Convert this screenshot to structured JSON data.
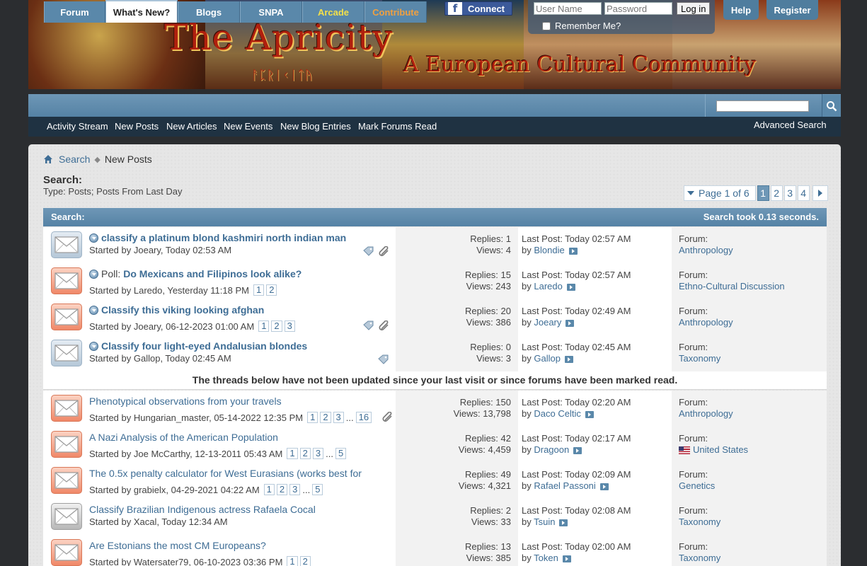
{
  "header": {
    "site_title": "The Apricity",
    "site_subtitle": "A European Cultural Community",
    "runes": "ᚨᛈᚱᛁᚲᛁᛏᚤ",
    "fb_connect": "Connect",
    "username_placeholder": "User Name",
    "password_placeholder": "Password",
    "login_label": "Log in",
    "remember_label": "Remember Me?",
    "help_label": "Help",
    "register_label": "Register"
  },
  "nav": {
    "tabs": [
      "Forum",
      "What's New?",
      "Blogs",
      "SNPA",
      "Arcade",
      "Contribute"
    ],
    "active_tab": "What's New?",
    "sub_links": [
      "Activity Stream",
      "New Posts",
      "New Articles",
      "New Events",
      "New Blog Entries",
      "Mark Forums Read"
    ],
    "advanced_search": "Advanced Search"
  },
  "breadcrumb": {
    "link": "Search",
    "current": "New Posts"
  },
  "search_info": {
    "heading": "Search:",
    "type": "Type: Posts; Posts From Last Day",
    "header_left": "Search:",
    "header_right": "Search took 0.13 seconds."
  },
  "pager": {
    "label": "Page 1 of 6",
    "pages": [
      "1",
      "2",
      "3",
      "4"
    ],
    "current": "1"
  },
  "notice": "The threads below have not been updated since your last visit or since forums have been marked read.",
  "threads": [
    {
      "icon": "blue",
      "new": true,
      "prefix": "",
      "title": "classify a platinum blond kashmiri north indian man",
      "bold": true,
      "started": "Started by Joeary, Today 02:53 AM",
      "pages": [],
      "replies": "Replies: 1",
      "views": "Views: 4",
      "last_post": "Last Post: Today 02:57 AM",
      "last_by_prefix": "by",
      "last_by": "Blondie",
      "forum_label": "Forum:",
      "forum": "Anthropology",
      "tags": true,
      "attach": true
    },
    {
      "icon": "orange",
      "new": true,
      "prefix": "Poll:",
      "title": "Do Mexicans and Filipinos look alike?",
      "bold": true,
      "started": "Started by Laredo, Yesterday 11:18 PM",
      "pages": [
        "1",
        "2"
      ],
      "replies": "Replies: 15",
      "views": "Views: 243",
      "last_post": "Last Post: Today 02:57 AM",
      "last_by_prefix": "by",
      "last_by": "Laredo",
      "forum_label": "Forum:",
      "forum": "Ethno-Cultural Discussion",
      "tags": false,
      "attach": false
    },
    {
      "icon": "orange",
      "new": true,
      "prefix": "",
      "title": "Classify this viking looking afghan",
      "bold": true,
      "started": "Started by Joeary, 06-12-2023 01:00 AM",
      "pages": [
        "1",
        "2",
        "3"
      ],
      "replies": "Replies: 20",
      "views": "Views: 386",
      "last_post": "Last Post: Today 02:49 AM",
      "last_by_prefix": "by",
      "last_by": "Joeary",
      "forum_label": "Forum:",
      "forum": "Anthropology",
      "tags": true,
      "attach": true
    },
    {
      "icon": "blue",
      "new": true,
      "prefix": "",
      "title": "Classify four light-eyed Andalusian blondes",
      "bold": true,
      "started": "Started by Gallop, Today 02:45 AM",
      "pages": [],
      "replies": "Replies: 0",
      "views": "Views: 3",
      "last_post": "Last Post: Today 02:45 AM",
      "last_by_prefix": "by",
      "last_by": "Gallop",
      "forum_label": "Forum:",
      "forum": "Taxonomy",
      "tags": true,
      "attach": false
    },
    {
      "icon": "orange",
      "new": false,
      "prefix": "",
      "title": "Phenotypical observations from your travels",
      "bold": false,
      "started": "Started by Hungarian_master, 05-14-2022 12:35 PM",
      "pages": [
        "1",
        "2",
        "3",
        "...",
        "16"
      ],
      "replies": "Replies: 150",
      "views": "Views: 13,798",
      "last_post": "Last Post: Today 02:20 AM",
      "last_by_prefix": "by",
      "last_by": "Daco Celtic",
      "forum_label": "Forum:",
      "forum": "Anthropology",
      "tags": false,
      "attach": true
    },
    {
      "icon": "orange",
      "new": false,
      "prefix": "",
      "title": "A Nazi Analysis of the American Population",
      "bold": false,
      "started": "Started by Joe McCarthy, 12-13-2011 05:43 AM",
      "pages": [
        "1",
        "2",
        "3",
        "...",
        "5"
      ],
      "replies": "Replies: 42",
      "views": "Views: 4,459",
      "last_post": "Last Post: Today 02:17 AM",
      "last_by_prefix": "by",
      "last_by": "Dragoon",
      "forum_label": "Forum:",
      "forum": "United States",
      "flag": true,
      "tags": false,
      "attach": false
    },
    {
      "icon": "orange",
      "new": false,
      "prefix": "",
      "title": "The 0.5x penalty calculator for West Eurasians (works best for",
      "bold": false,
      "started": "Started by grabielx, 04-29-2021 04:22 AM",
      "pages": [
        "1",
        "2",
        "3",
        "...",
        "5"
      ],
      "replies": "Replies: 49",
      "views": "Views: 4,321",
      "last_post": "Last Post: Today 02:09 AM",
      "last_by_prefix": "by",
      "last_by": "Rafael Passoni",
      "forum_label": "Forum:",
      "forum": "Genetics",
      "tags": false,
      "attach": false
    },
    {
      "icon": "grey",
      "new": false,
      "prefix": "",
      "title": "Classify Brazilian Indigenous actress Rafaela Cocal",
      "bold": false,
      "started": "Started by Xacal, Today 12:34 AM",
      "pages": [],
      "replies": "Replies: 2",
      "views": "Views: 33",
      "last_post": "Last Post: Today 02:08 AM",
      "last_by_prefix": "by",
      "last_by": "Tsuin",
      "forum_label": "Forum:",
      "forum": "Taxonomy",
      "tags": false,
      "attach": false
    },
    {
      "icon": "orange",
      "new": false,
      "prefix": "",
      "title": "Are Estonians the most CM Europeans?",
      "bold": false,
      "started": "Started by Watersater79, 06-10-2023 03:36 PM",
      "pages": [
        "1",
        "2"
      ],
      "replies": "Replies: 13",
      "views": "Views: 385",
      "last_post": "Last Post: Today 02:00 AM",
      "last_by_prefix": "by",
      "last_by": "Token",
      "forum_label": "Forum:",
      "forum": "Taxonomy",
      "tags": false,
      "attach": false
    }
  ]
}
